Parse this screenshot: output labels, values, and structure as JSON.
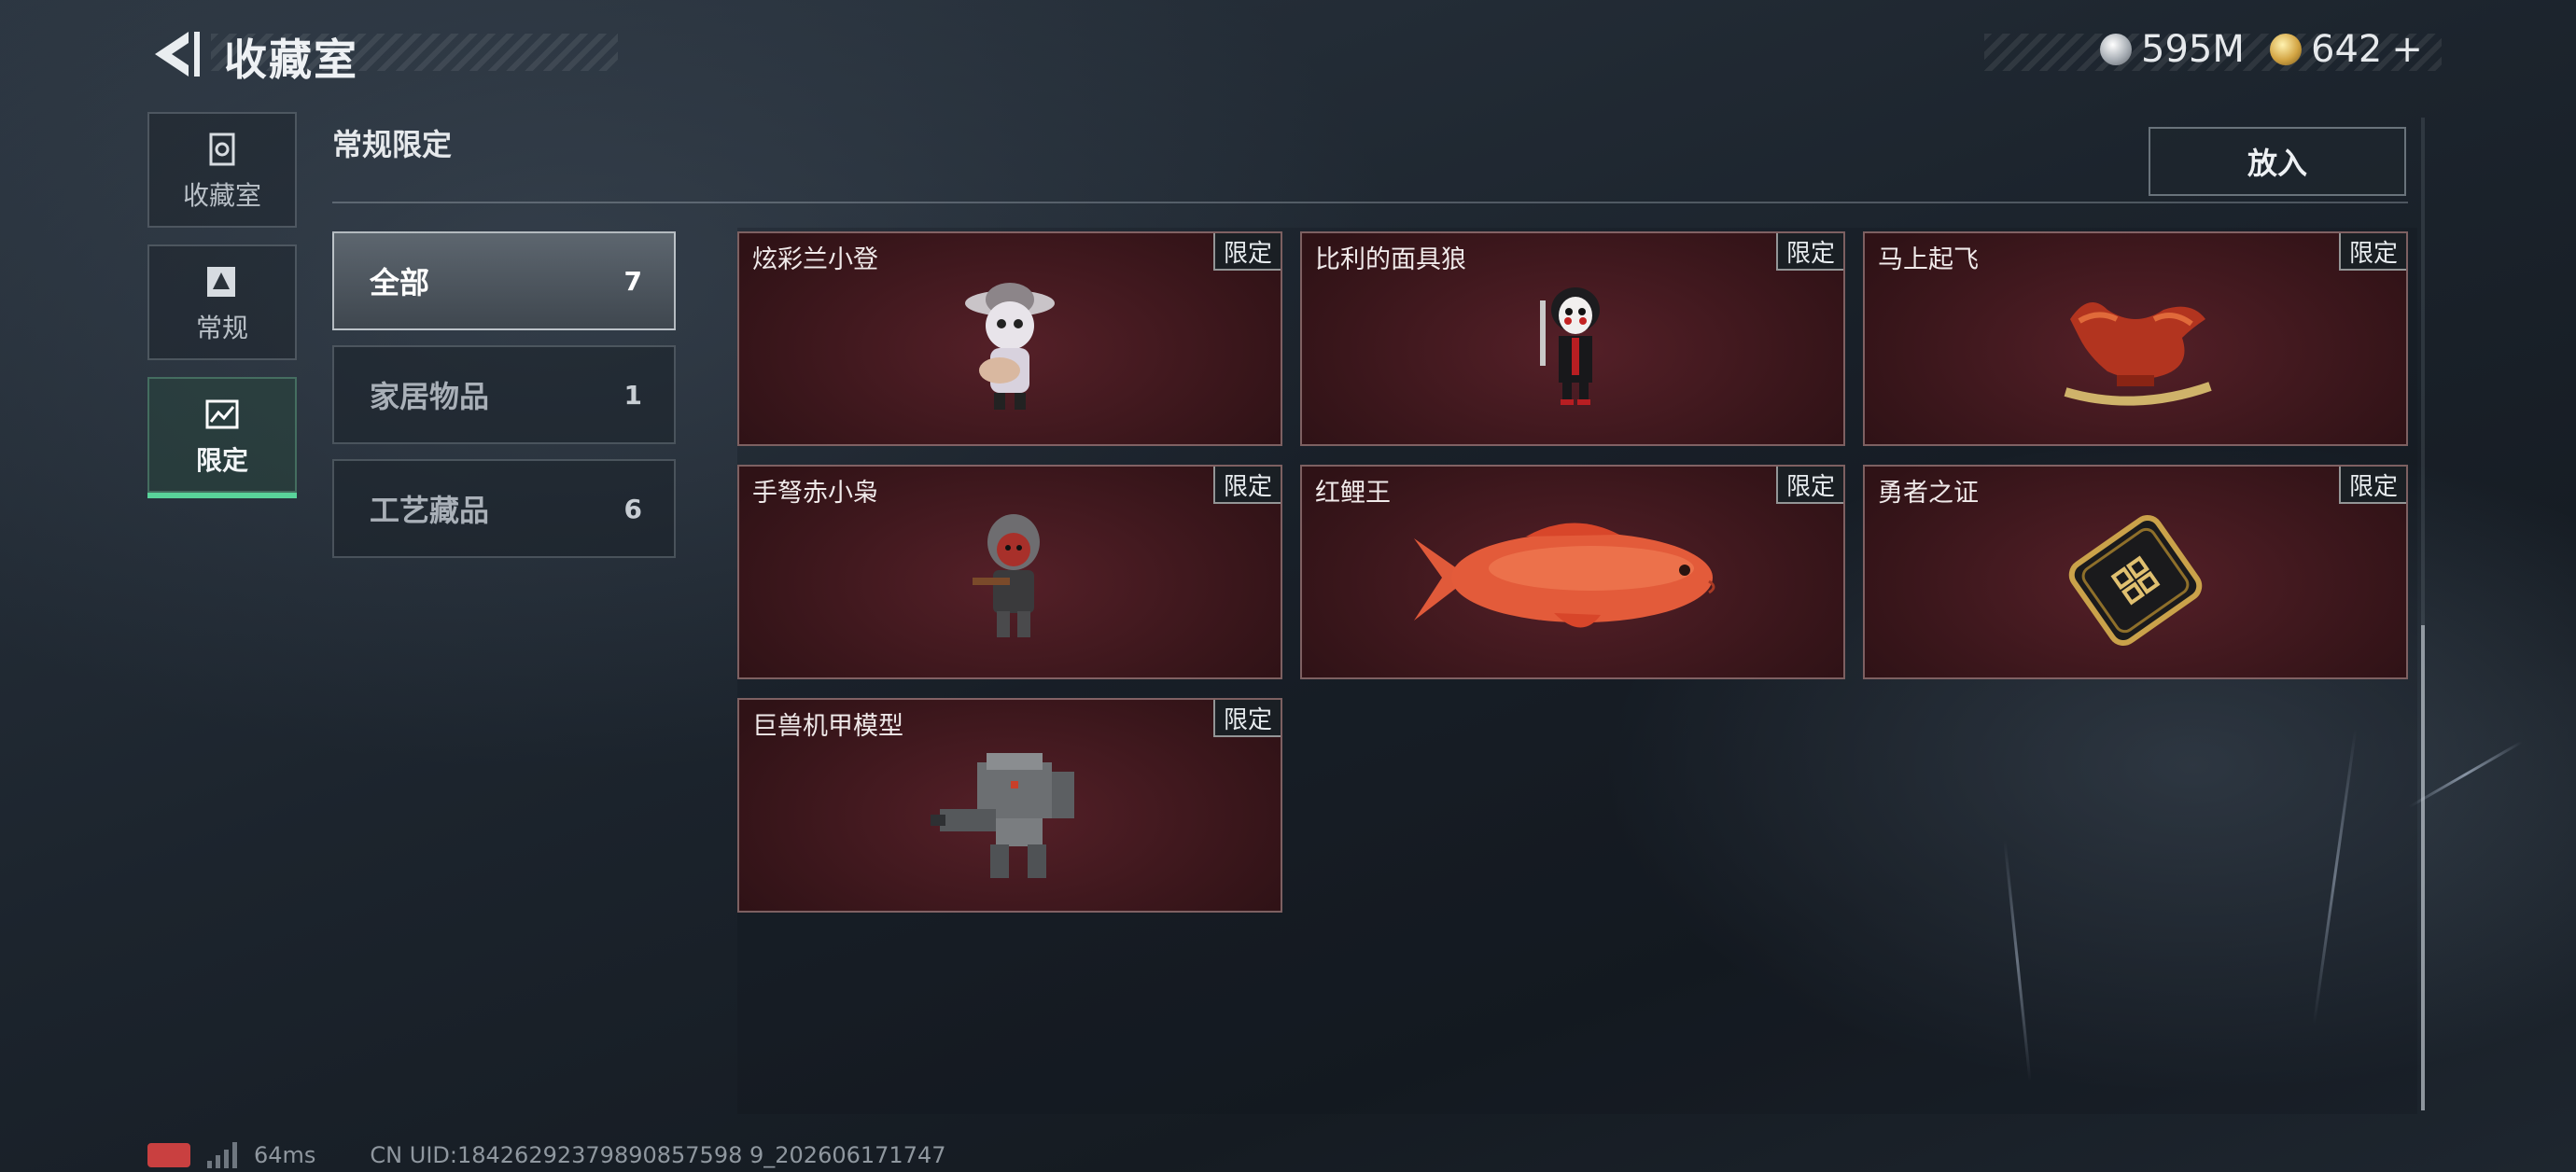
{
  "header": {
    "title": "收藏室",
    "currency": [
      {
        "icon": "silver-coin-icon",
        "value": "595M"
      },
      {
        "icon": "gold-coin-icon",
        "value": "642"
      }
    ],
    "add_symbol": "+"
  },
  "nav": {
    "items": [
      {
        "label": "收藏室",
        "icon": "collection-room-icon"
      },
      {
        "label": "常规",
        "icon": "regular-icon"
      },
      {
        "label": "限定",
        "icon": "limited-icon",
        "active": true
      }
    ]
  },
  "section": {
    "title": "常规限定",
    "place_button": "放入"
  },
  "filters": [
    {
      "label": "全部",
      "count": "7",
      "active": true
    },
    {
      "label": "家居物品",
      "count": "1"
    },
    {
      "label": "工艺藏品",
      "count": "6"
    }
  ],
  "items": [
    {
      "name": "炫彩兰小登",
      "tag": "限定",
      "icon": "skeleton-guitar-figure-icon"
    },
    {
      "name": "比利的面具狼",
      "tag": "限定",
      "icon": "puppet-mask-figure-icon"
    },
    {
      "name": "马上起飞",
      "tag": "限定",
      "icon": "red-horse-statue-icon"
    },
    {
      "name": "手弩赤小枭",
      "tag": "限定",
      "icon": "hooded-crossbow-figure-icon"
    },
    {
      "name": "红鲤王",
      "tag": "限定",
      "icon": "red-carp-icon"
    },
    {
      "name": "勇者之证",
      "tag": "限定",
      "icon": "gold-card-icon"
    },
    {
      "name": "巨兽机甲模型",
      "tag": "限定",
      "icon": "mech-model-icon"
    }
  ],
  "footer": {
    "ping": "64ms",
    "uid": "CN UID:18426292379890857598 9_202606171747"
  },
  "colors": {
    "accent": "#59d39a",
    "card_bg": "#3a161b"
  }
}
